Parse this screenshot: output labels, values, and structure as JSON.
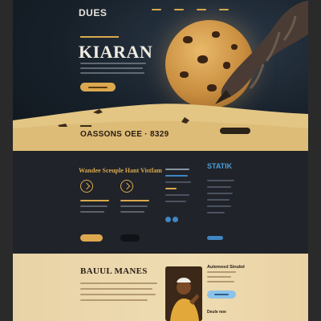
{
  "hero": {
    "logo": "DUES",
    "title": "KIARAN",
    "stats": "OASSONS OEE  ·  8329"
  },
  "services": {
    "title": "Wandee Sceuple Hant Vistfam",
    "statik": "STATIK"
  },
  "about": {
    "title": "BAUUL MANES",
    "side_title": "Aulemosd Sinubd",
    "footer": "Deule noe"
  },
  "colors": {
    "accent": "#d9a94e",
    "blue": "#3f86c4",
    "dark": "#1b1e24",
    "sand": "#e8d3a6"
  }
}
